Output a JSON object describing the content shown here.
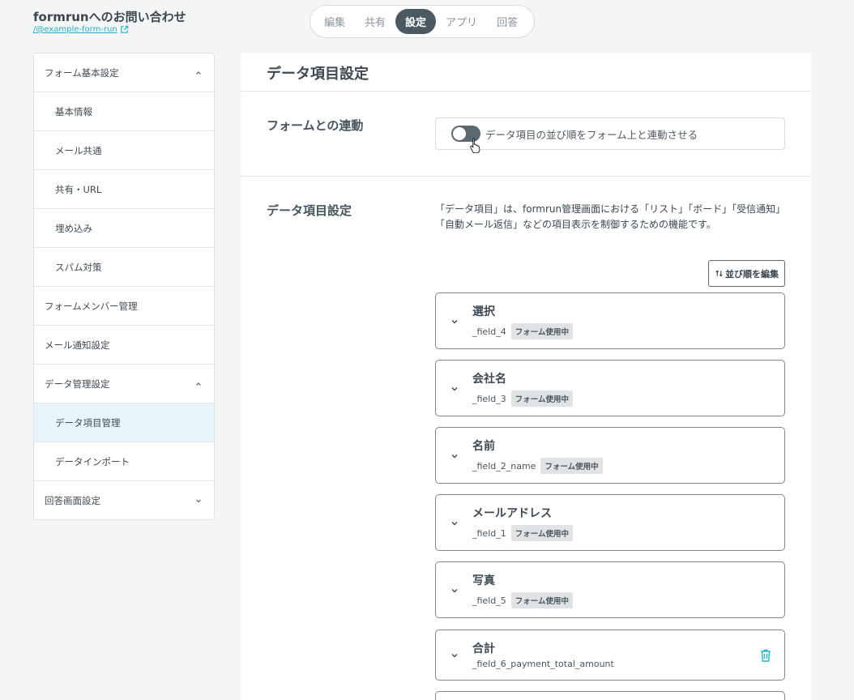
{
  "header": {
    "form_title": "formrunへのお問い合わせ",
    "form_link": "/@example-form-run",
    "tabs": [
      {
        "label": "編集",
        "active": false
      },
      {
        "label": "共有",
        "active": false
      },
      {
        "label": "設定",
        "active": true
      },
      {
        "label": "アプリ",
        "active": false
      },
      {
        "label": "回答",
        "active": false
      }
    ]
  },
  "sidebar": {
    "items": [
      {
        "label": "フォーム基本設定",
        "chevron": "up"
      },
      {
        "label": "基本情報"
      },
      {
        "label": "メール共通"
      },
      {
        "label": "共有・URL"
      },
      {
        "label": "埋め込み"
      },
      {
        "label": "スパム対策"
      },
      {
        "label": "フォームメンバー管理"
      },
      {
        "label": "メール通知設定"
      },
      {
        "label": "データ管理設定",
        "chevron": "up"
      },
      {
        "label": "データ項目管理",
        "active": true
      },
      {
        "label": "データインポート"
      },
      {
        "label": "回答画面設定",
        "chevron": "down"
      }
    ]
  },
  "main": {
    "title": "データ項目設定",
    "form_link_section": {
      "label": "フォームとの連動",
      "toggle_label": "データ項目の並び順をフォーム上と連動させる",
      "toggle_on": false
    },
    "data_section": {
      "label": "データ項目設定",
      "description": "「データ項目」は、formrun管理画面における「リスト」「ボード」「受信通知」「自動メール返信」などの項目表示を制御するための機能です。",
      "edit_order_label": "並び順を編集",
      "fields": [
        {
          "name": "選択",
          "key": "_field_4",
          "badge": "フォーム使用中"
        },
        {
          "name": "会社名",
          "key": "_field_3",
          "badge": "フォーム使用中"
        },
        {
          "name": "名前",
          "key": "_field_2_name",
          "badge": "フォーム使用中"
        },
        {
          "name": "メールアドレス",
          "key": "_field_1",
          "badge": "フォーム使用中"
        },
        {
          "name": "写真",
          "key": "_field_5",
          "badge": "フォーム使用中"
        },
        {
          "name": "合計",
          "key": "_field_6_payment_total_amount",
          "badge": "",
          "deletable": true
        }
      ]
    }
  },
  "colors": {
    "accent": "#25b3c5",
    "active_tab": "#4a5962",
    "sidebar_active": "#e7f6fa"
  }
}
